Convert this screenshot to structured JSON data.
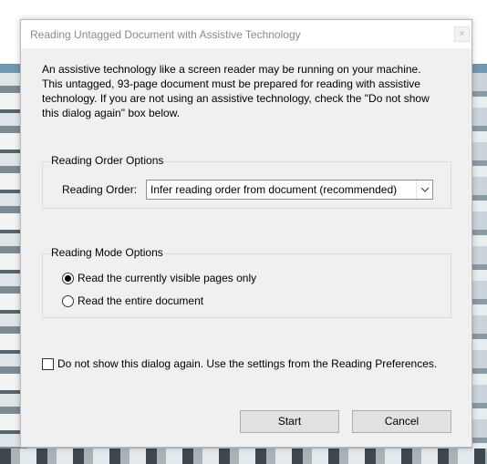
{
  "dialog": {
    "title": "Reading Untagged Document with Assistive Technology",
    "close_glyph": "×",
    "intro_text": "An assistive technology like a screen reader may be running on your machine. This untagged, 93-page document must be prepared for reading with assistive technology. If you are not using an assistive technology, check the \"Do not show this dialog again\" box below."
  },
  "reading_order": {
    "group_label": "Reading Order Options",
    "field_label": "Reading Order:",
    "selected_value": "Infer reading order from document (recommended)"
  },
  "reading_mode": {
    "group_label": "Reading Mode Options",
    "options": [
      {
        "label": "Read the currently visible pages only",
        "checked": true
      },
      {
        "label": "Read the entire document",
        "checked": false
      }
    ]
  },
  "dont_show": {
    "label": "Do not show this dialog again. Use the settings from the Reading Preferences.",
    "checked": false
  },
  "buttons": {
    "start_label": "Start",
    "cancel_label": "Cancel"
  }
}
